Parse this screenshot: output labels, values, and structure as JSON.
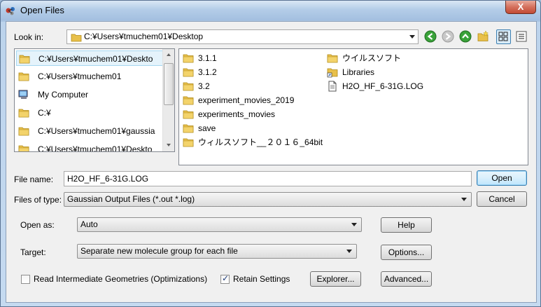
{
  "window": {
    "title": "Open Files",
    "close_label": "X"
  },
  "look_in": {
    "label": "Look in:",
    "value": "C:¥Users¥tmuchem01¥Desktop"
  },
  "toolbar": {
    "icons": [
      "back-icon",
      "forward-icon",
      "up-icon",
      "new-folder-icon",
      "list-view-icon",
      "detail-view-icon"
    ]
  },
  "sidebar": {
    "items": [
      {
        "label": "C:¥Users¥tmuchem01¥Deskto",
        "icon": "folder-icon",
        "selected": true
      },
      {
        "label": "C:¥Users¥tmuchem01",
        "icon": "folder-icon"
      },
      {
        "label": "My Computer",
        "icon": "computer-icon"
      },
      {
        "label": "C:¥",
        "icon": "folder-icon"
      },
      {
        "label": "C:¥Users¥tmuchem01¥gaussia",
        "icon": "folder-icon"
      },
      {
        "label": "C:¥Users¥tmuchem01¥Deskto",
        "icon": "folder-icon"
      }
    ]
  },
  "files": {
    "col1": [
      {
        "name": "3.1.1",
        "type": "folder"
      },
      {
        "name": "3.1.2",
        "type": "folder"
      },
      {
        "name": "3.2",
        "type": "folder"
      },
      {
        "name": "experiment_movies_2019",
        "type": "folder"
      },
      {
        "name": "experiments_movies",
        "type": "folder"
      },
      {
        "name": "save",
        "type": "folder"
      },
      {
        "name": "ウィルスソフト__２０１６_64bit",
        "type": "folder"
      }
    ],
    "col2": [
      {
        "name": "ウイルスソフト",
        "type": "folder"
      },
      {
        "name": "Libraries",
        "type": "library"
      },
      {
        "name": "H2O_HF_6-31G.LOG",
        "type": "file"
      }
    ]
  },
  "file_name": {
    "label": "File name:",
    "value": "H2O_HF_6-31G.LOG"
  },
  "file_type": {
    "label": "Files of type:",
    "value": "Gaussian Output Files (*.out *.log)"
  },
  "buttons": {
    "open": "Open",
    "cancel": "Cancel",
    "help": "Help",
    "options": "Options...",
    "explorer": "Explorer...",
    "advanced": "Advanced..."
  },
  "open_as": {
    "label": "Open as:",
    "value": "Auto"
  },
  "target": {
    "label": "Target:",
    "value": "Separate new molecule group for each file"
  },
  "checkboxes": {
    "read_intermediate": {
      "label": "Read Intermediate Geometries (Optimizations)",
      "checked": false
    },
    "retain_settings": {
      "label": "Retain Settings",
      "checked": true
    }
  }
}
